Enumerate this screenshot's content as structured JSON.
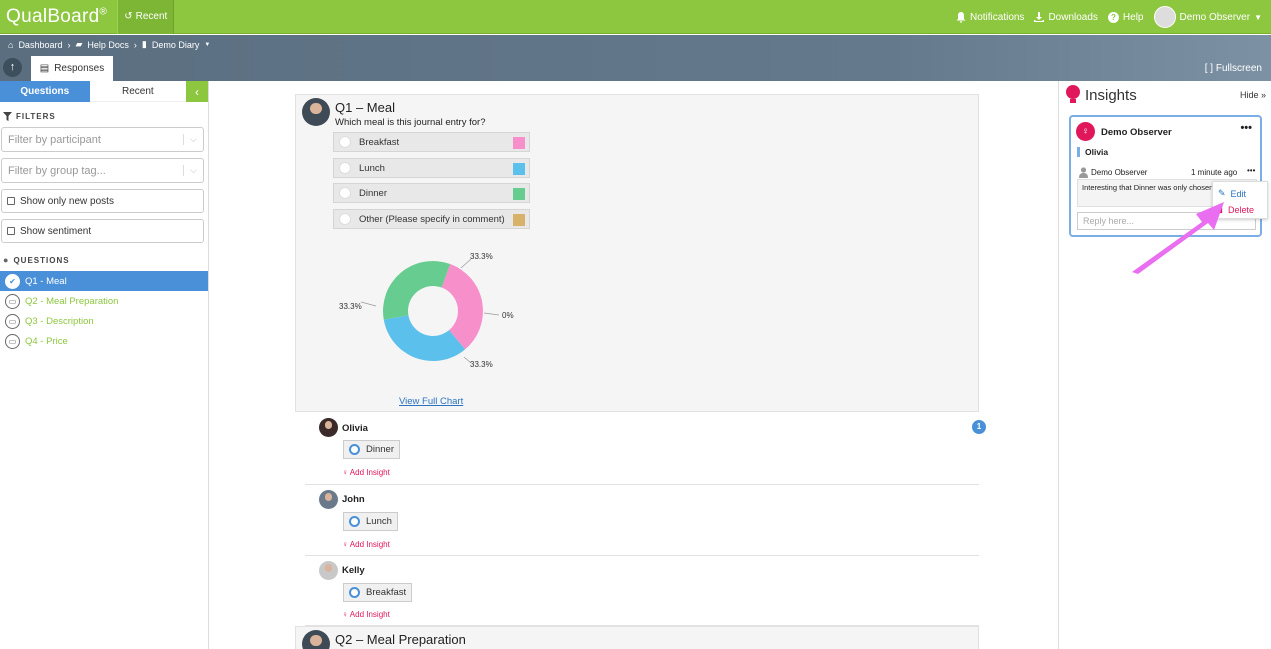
{
  "topbar": {
    "logo": "QualBoard",
    "logo_mark": "®",
    "recent": "Recent",
    "notifications": "Notifications",
    "downloads": "Downloads",
    "help": "Help",
    "user": "Demo Observer"
  },
  "breadcrumb": {
    "dashboard": "Dashboard",
    "help_docs": "Help Docs",
    "demo_diary": "Demo Diary"
  },
  "tabs": {
    "responses": "Responses",
    "fullscreen": "Fullscreen"
  },
  "left": {
    "tab_questions": "Questions",
    "tab_recent": "Recent",
    "filters_heading": "FILTERS",
    "filter_participant": "Filter by participant",
    "filter_group": "Filter by group tag...",
    "show_new": "Show only new posts",
    "show_sentiment": "Show sentiment",
    "questions_heading": "QUESTIONS",
    "questions": [
      {
        "label": "Q1 - Meal"
      },
      {
        "label": "Q2 - Meal Preparation"
      },
      {
        "label": "Q3 - Description"
      },
      {
        "label": "Q4 - Price"
      }
    ]
  },
  "question": {
    "title": "Q1 – Meal",
    "subtitle": "Which meal is this journal entry for?",
    "options": [
      {
        "label": "Breakfast",
        "color": "#f78fcb"
      },
      {
        "label": "Lunch",
        "color": "#5bc0eb"
      },
      {
        "label": "Dinner",
        "color": "#66cc8f"
      },
      {
        "label": "Other (Please specify in comment)",
        "color": "#d8b26a"
      }
    ],
    "view_full_chart": "View Full Chart"
  },
  "chart_data": {
    "type": "pie",
    "categories": [
      "Breakfast",
      "Lunch",
      "Dinner",
      "Other (Please specify in comment)"
    ],
    "values": [
      33.3,
      33.3,
      33.3,
      0
    ],
    "labels": [
      "33.3%",
      "33.3%",
      "33.3%",
      "0%"
    ],
    "colors": [
      "#f78fcb",
      "#5bc0eb",
      "#66cc8f",
      "#d8b26a"
    ]
  },
  "responses": [
    {
      "name": "Olivia",
      "answer": "Dinner",
      "add_insight": "Add Insight",
      "badge": "1"
    },
    {
      "name": "John",
      "answer": "Lunch",
      "add_insight": "Add Insight"
    },
    {
      "name": "Kelly",
      "answer": "Breakfast",
      "add_insight": "Add Insight"
    }
  ],
  "next_question": {
    "title": "Q2 – Meal Preparation"
  },
  "insights": {
    "title": "Insights",
    "hide": "Hide",
    "card": {
      "owner": "Demo Observer",
      "participant": "Olivia",
      "comment_author": "Demo Observer",
      "comment_time": "1 minute ago",
      "comment_text": "Interesting that Dinner was only chosen once",
      "reply_placeholder": "Reply here...",
      "menu_edit": "Edit",
      "menu_delete": "Delete"
    }
  }
}
